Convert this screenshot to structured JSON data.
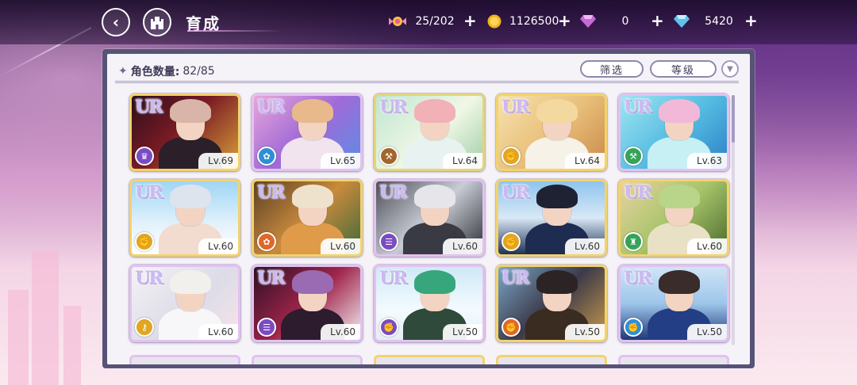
{
  "header": {
    "back_icon": "back-arrow-icon",
    "home_icon": "castle-icon",
    "title": "育成"
  },
  "resources": [
    {
      "icon": "candy-icon",
      "value": "25/202"
    },
    {
      "icon": "gold-coin-icon",
      "value": "1126500"
    },
    {
      "icon": "pink-diamond-icon",
      "value": "0"
    },
    {
      "icon": "blue-diamond-icon",
      "value": "5420"
    }
  ],
  "panel": {
    "count_label": "角色数量:",
    "count_value": "82/85",
    "filter_label": "筛选",
    "sort_label": "等级"
  },
  "attr_colors": {
    "purple": "#7b4bc2",
    "blue": "#2f8fd6",
    "brown": "#a2662c",
    "yellow": "#e0a521",
    "green": "#36a35a",
    "orange": "#e0672a"
  },
  "cards": [
    {
      "rarity": "UR",
      "level": "Lv.69",
      "attr": "purple",
      "attr_icon": "crown-icon",
      "art": "red-dark"
    },
    {
      "rarity": "UR",
      "level": "Lv.65",
      "attr": "blue",
      "attr_icon": "palette-icon",
      "art": "pink-purple"
    },
    {
      "rarity": "UR",
      "level": "Lv.64",
      "attr": "brown",
      "attr_icon": "hammer-icon",
      "art": "mint"
    },
    {
      "rarity": "UR",
      "level": "Lv.64",
      "attr": "yellow",
      "attr_icon": "fist-icon",
      "art": "gold"
    },
    {
      "rarity": "UR",
      "level": "Lv.63",
      "attr": "green",
      "attr_icon": "hammer-icon",
      "art": "aqua"
    },
    {
      "rarity": "UR",
      "level": "Lv.60",
      "attr": "yellow",
      "attr_icon": "fist-icon",
      "art": "sky"
    },
    {
      "rarity": "UR",
      "level": "Lv.60",
      "attr": "orange",
      "attr_icon": "palette-icon",
      "art": "autumn"
    },
    {
      "rarity": "UR",
      "level": "Lv.60",
      "attr": "purple",
      "attr_icon": "book-icon",
      "art": "gray"
    },
    {
      "rarity": "UR",
      "level": "Lv.60",
      "attr": "yellow",
      "attr_icon": "fist-icon",
      "art": "navy"
    },
    {
      "rarity": "UR",
      "level": "Lv.60",
      "attr": "green",
      "attr_icon": "hat-icon",
      "art": "forest"
    },
    {
      "rarity": "UR",
      "level": "Lv.60",
      "attr": "yellow",
      "attr_icon": "key-icon",
      "art": "white"
    },
    {
      "rarity": "UR",
      "level": "Lv.60",
      "attr": "purple",
      "attr_icon": "book-icon",
      "art": "crimson"
    },
    {
      "rarity": "UR",
      "level": "Lv.50",
      "attr": "purple",
      "attr_icon": "fist-icon",
      "art": "angel"
    },
    {
      "rarity": "UR",
      "level": "Lv.50",
      "attr": "orange",
      "attr_icon": "fist-icon",
      "art": "pirate"
    },
    {
      "rarity": "UR",
      "level": "Lv.50",
      "attr": "blue",
      "attr_icon": "fist-icon",
      "art": "blue-suit"
    }
  ]
}
